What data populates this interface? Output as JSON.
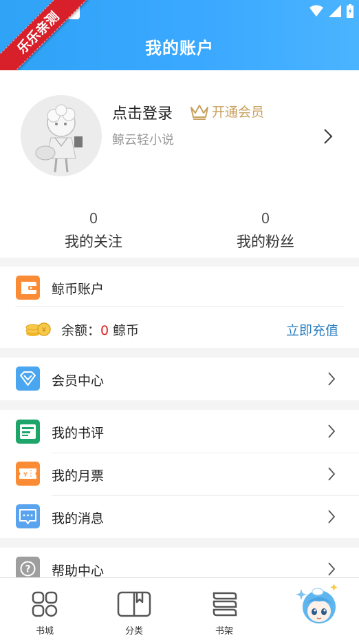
{
  "header": {
    "title": "我的账户"
  },
  "ribbon": {
    "text": "乐乐亲测"
  },
  "profile": {
    "login_text": "点击登录",
    "vip_text": "开通会员",
    "subtitle": "鲸云轻小说",
    "stats": [
      {
        "count": "0",
        "label": "我的关注"
      },
      {
        "count": "0",
        "label": "我的粉丝"
      }
    ]
  },
  "wallet": {
    "title": "鲸币账户",
    "balance_label": "余额：",
    "balance_value": "0",
    "balance_unit": "鲸币",
    "recharge": "立即充值"
  },
  "menu": {
    "vip_center": "会员中心",
    "book_reviews": "我的书评",
    "monthly_tickets": "我的月票",
    "messages": "我的消息",
    "help": "帮助中心"
  },
  "tabbar": {
    "tabs": [
      {
        "label": "书城",
        "icon": "bookstore-icon"
      },
      {
        "label": "分类",
        "icon": "category-icon"
      },
      {
        "label": "书架",
        "icon": "bookshelf-icon"
      },
      {
        "label": "",
        "icon": "mascot-avatar-icon"
      }
    ]
  },
  "colors": {
    "header_blue": "#3aa8ff",
    "accent_red": "#e02020",
    "link_blue": "#2d7fc0",
    "vip_gold": "#c8a15e"
  }
}
